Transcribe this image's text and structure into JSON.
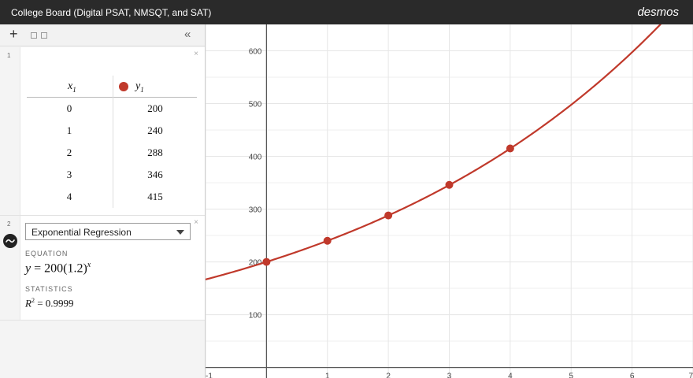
{
  "window": {
    "title": "College Board (Digital PSAT, NMSQT, and SAT)",
    "brand": "desmos"
  },
  "toolbar": {
    "add_label": "+",
    "collapse_label": "«"
  },
  "expressions": {
    "table": {
      "number": "1",
      "delete_label": "×",
      "headers": {
        "x": "x",
        "x_sub": "1",
        "y": "y",
        "y_sub": "1"
      },
      "rows": [
        {
          "x": "0",
          "y": "200"
        },
        {
          "x": "1",
          "y": "240"
        },
        {
          "x": "2",
          "y": "288"
        },
        {
          "x": "3",
          "y": "346"
        },
        {
          "x": "4",
          "y": "415"
        }
      ]
    },
    "regression": {
      "number": "2",
      "delete_label": "×",
      "type_selected": "Exponential Regression",
      "equation_label": "EQUATION",
      "eq_y": "y",
      "eq_body": " = 200(1.2)",
      "eq_exp": "x",
      "statistics_label": "STATISTICS",
      "r_label": "R",
      "r_exp": "2",
      "r_value": " = 0.9999"
    }
  },
  "colors": {
    "series": "#c0392b",
    "grid": "#e6e6e6",
    "axis": "#555555"
  },
  "chart_data": {
    "type": "scatter",
    "x": [
      0,
      1,
      2,
      3,
      4
    ],
    "y": [
      200,
      240,
      288,
      346,
      415
    ],
    "curve": {
      "a": 200,
      "b": 1.2
    },
    "xlim": [
      -1,
      7
    ],
    "ylim": [
      -20,
      650
    ],
    "x_ticks": [
      "-1",
      "1",
      "2",
      "3",
      "4",
      "5",
      "6",
      "7"
    ],
    "y_ticks": [
      "100",
      "200",
      "300",
      "400",
      "500",
      "600"
    ],
    "grid": true
  }
}
